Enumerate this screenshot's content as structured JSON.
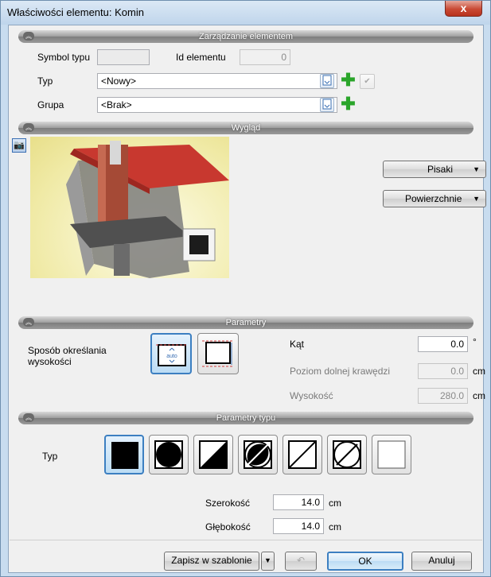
{
  "window": {
    "title": "Właściwości elementu: Komin",
    "close_glyph": "x"
  },
  "sections": {
    "management": "Zarządzanie elementem",
    "appearance": "Wygląd",
    "parameters": "Parametry",
    "type_parameters": "Parametry typu"
  },
  "management": {
    "symbol_label": "Symbol typu",
    "symbol_value": "",
    "id_label": "Id elementu",
    "id_value": "0",
    "type_label": "Typ",
    "type_value": "<Nowy>",
    "group_label": "Grupa",
    "group_value": "<Brak>"
  },
  "appearance": {
    "pens_button": "Pisaki",
    "surfaces_button": "Powierzchnie"
  },
  "parameters": {
    "height_mode_label_1": "Sposób określania",
    "height_mode_label_2": "wysokości",
    "auto_label": "auto",
    "angle_label": "Kąt",
    "angle_value": "0.0",
    "angle_unit": "°",
    "bottom_label": "Poziom dolnej krawędzi",
    "bottom_value": "0.0",
    "bottom_unit": "cm",
    "height_label": "Wysokość",
    "height_value": "280.0",
    "height_unit": "cm"
  },
  "type_parameters": {
    "type_label": "Typ",
    "width_label": "Szerokość",
    "width_value": "14.0",
    "width_unit": "cm",
    "depth_label": "Głębokość",
    "depth_value": "14.0",
    "depth_unit": "cm"
  },
  "footer": {
    "save_template": "Zapisz w szablonie",
    "ok": "OK",
    "cancel": "Anuluj"
  },
  "colors": {
    "selected_border": "#3c7fc1",
    "plus_green": "#2aa52a",
    "close_red": "#c94a34"
  }
}
